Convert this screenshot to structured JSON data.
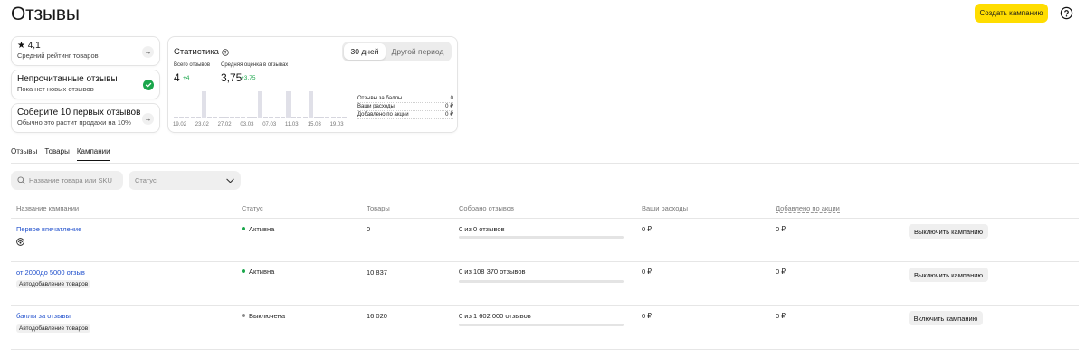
{
  "header": {
    "title": "Отзывы",
    "create_label": "Создать кампанию"
  },
  "side_cards": [
    {
      "title": "4,1",
      "subtitle": "Средний рейтинг товаров"
    },
    {
      "title": "Непрочитанные отзывы",
      "subtitle": "Пока нет новых отзывов"
    },
    {
      "title": "Соберите 10 первых отзывов",
      "subtitle": "Обычно это растит продажи на 10%"
    }
  ],
  "stats": {
    "title": "Статистика",
    "period_active": "30 дней",
    "period_other": "Другой период",
    "total_label": "Всего отзывов",
    "total_value": "4",
    "total_delta": "+4",
    "avg_label": "Средняя оценка в отзывах",
    "avg_value": "3,75",
    "avg_delta": "+3,75",
    "chart_data": {
      "type": "bar",
      "values": [
        0,
        0,
        0,
        0,
        0,
        1,
        0,
        0,
        0,
        0,
        0,
        0,
        0,
        0,
        0,
        1,
        0,
        0,
        0,
        0,
        1,
        0,
        0,
        0,
        1,
        0,
        0,
        0,
        0,
        0,
        0
      ],
      "x_ticks": [
        "19.02",
        "23.02",
        "27.02",
        "03.03",
        "07.03",
        "11.03",
        "15.03",
        "19.03"
      ]
    },
    "summary": [
      {
        "label": "Отзывы за баллы",
        "value": "0"
      },
      {
        "label": "Ваши расходы",
        "value": "0 ₽"
      },
      {
        "label": "Добавлено по акции",
        "value": "0 ₽"
      }
    ]
  },
  "tabs": [
    "Отзывы",
    "Товары",
    "Кампании"
  ],
  "filters": {
    "search_placeholder": "Название товара или SKU",
    "status_placeholder": "Статус"
  },
  "table": {
    "columns": [
      "Название кампании",
      "Статус",
      "Товары",
      "Собрано отзывов",
      "Ваши расходы",
      "Добавлено по акции"
    ],
    "rows": [
      {
        "name": "Первое впечатление",
        "tag": "",
        "status": "Активна",
        "status_color": "#1aa64b",
        "products": "0",
        "collected": "0 из 0 отзывов",
        "progress": 0,
        "spent": "0 ₽",
        "added": "0 ₽",
        "action": "Выключить кампанию"
      },
      {
        "name": "от 2000до 5000 отзыв",
        "tag": "Автодобавление товаров",
        "status": "Активна",
        "status_color": "#1aa64b",
        "products": "10 837",
        "collected": "0 из 108 370 отзывов",
        "progress": 0,
        "spent": "0 ₽",
        "added": "0 ₽",
        "action": "Выключить кампанию"
      },
      {
        "name": "баллы за отзывы",
        "tag": "Автодобавление товаров",
        "status": "Выключена",
        "status_color": "#8a8a8a",
        "products": "16 020",
        "collected": "0 из 1 602 000 отзывов",
        "progress": 0,
        "spent": "0 ₽",
        "added": "0 ₽",
        "action": "Включить кампанию"
      }
    ]
  }
}
